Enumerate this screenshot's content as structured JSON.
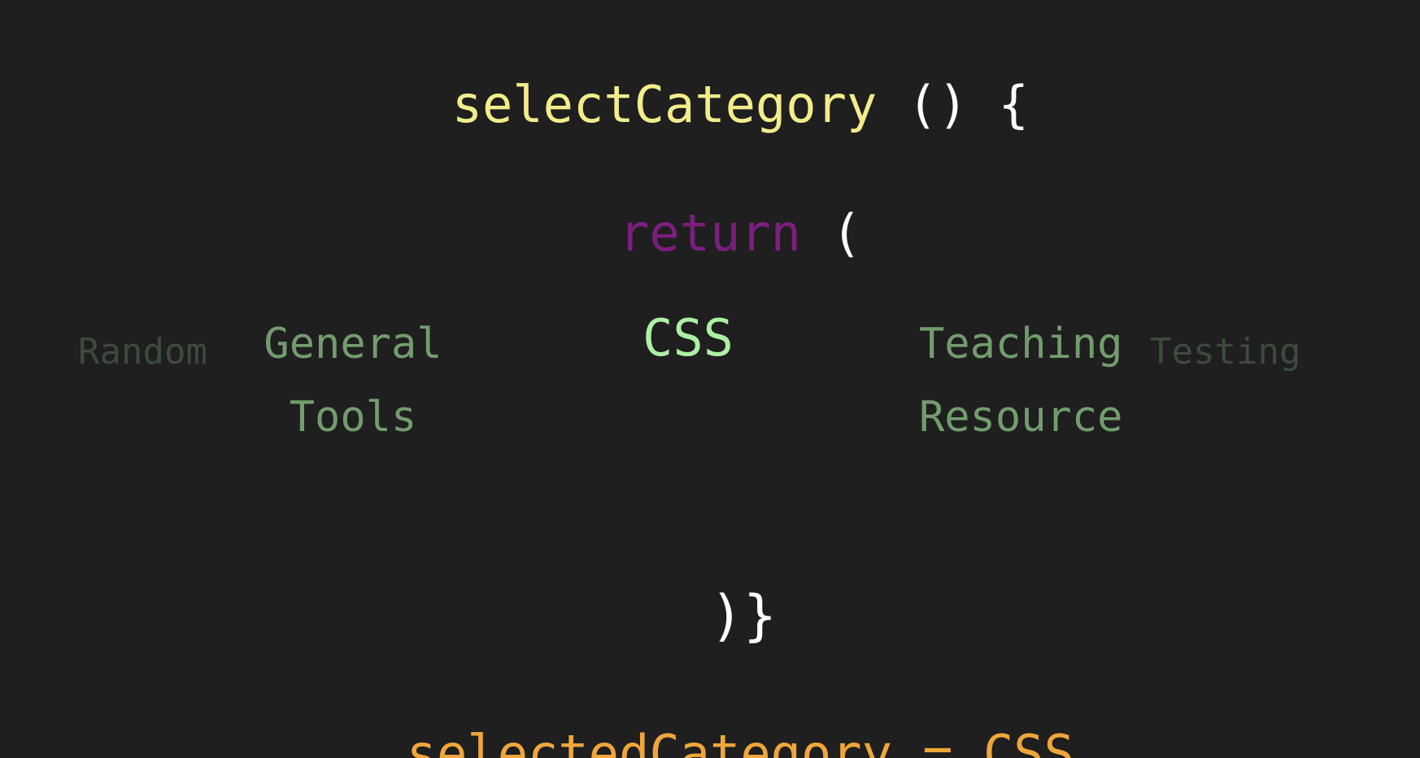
{
  "code": {
    "fn_name": "selectCategory",
    "fn_parens": " () {",
    "return_kw": "return",
    "return_paren": " (",
    "closing": ")}",
    "result_text": "selectedCategory = CSS"
  },
  "carousel": {
    "selected": "CSS",
    "left_near": "General\nTools",
    "left_far": "Random",
    "right_near": "Teaching\nResource",
    "right_far": "Testing"
  },
  "colors": {
    "background": "#1f1f1f",
    "function_name": "#f3ec8a",
    "punctuation": "#ffffff",
    "return_keyword": "#7b1f7e",
    "selected_category": "#aef0a5",
    "adjacent_category": "#739c6e",
    "distant_category": "#3c4b3d",
    "result": "#f0a63a"
  }
}
